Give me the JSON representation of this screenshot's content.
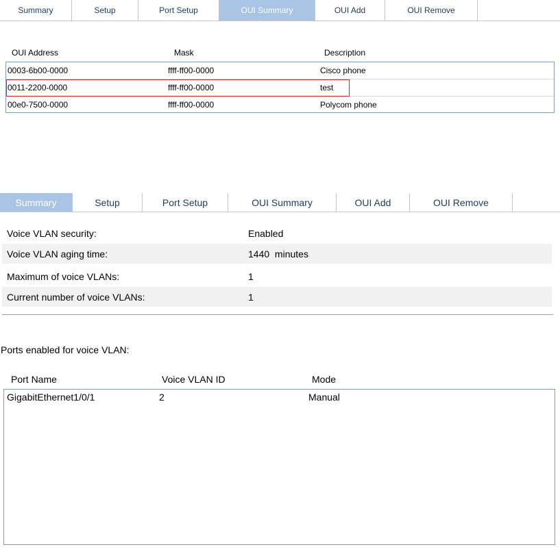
{
  "tabs_top": [
    {
      "label": "Summary",
      "active": false
    },
    {
      "label": "Setup",
      "active": false
    },
    {
      "label": "Port Setup",
      "active": false
    },
    {
      "label": "OUI Summary",
      "active": true
    },
    {
      "label": "OUI Add",
      "active": false
    },
    {
      "label": "OUI Remove",
      "active": false
    }
  ],
  "oui_table": {
    "headers": [
      "OUI Address",
      "Mask",
      "Description"
    ],
    "rows": [
      {
        "address": "0003-6b00-0000",
        "mask": "ffff-ff00-0000",
        "description": "Cisco phone",
        "highlighted": false
      },
      {
        "address": "0011-2200-0000",
        "mask": "ffff-ff00-0000",
        "description": "test",
        "highlighted": true
      },
      {
        "address": "00e0-7500-0000",
        "mask": "ffff-ff00-0000",
        "description": "Polycom phone",
        "highlighted": false
      }
    ]
  },
  "tabs_bottom": [
    {
      "label": "Summary",
      "active": true
    },
    {
      "label": "Setup",
      "active": false
    },
    {
      "label": "Port Setup",
      "active": false
    },
    {
      "label": "OUI Summary",
      "active": false
    },
    {
      "label": "OUI Add",
      "active": false
    },
    {
      "label": "OUI Remove",
      "active": false
    }
  ],
  "summary": {
    "rows": [
      {
        "label": "Voice VLAN security:",
        "value": "Enabled"
      },
      {
        "label": "Voice VLAN aging time:",
        "value": "1440  minutes"
      },
      {
        "label": "Maximum of voice VLANs:",
        "value": "1"
      },
      {
        "label": "Current number of voice VLANs:",
        "value": "1"
      }
    ]
  },
  "ports": {
    "title": "Ports enabled for voice VLAN:",
    "headers": [
      "Port Name",
      "Voice VLAN ID",
      "Mode"
    ],
    "rows": [
      {
        "name": "GigabitEthernet1/0/1",
        "vlan_id": "2",
        "mode": "Manual"
      }
    ]
  },
  "colors": {
    "active_tab": "#a9c4e4",
    "highlight_border": "#d9232b",
    "box_border": "#7f9db9"
  }
}
